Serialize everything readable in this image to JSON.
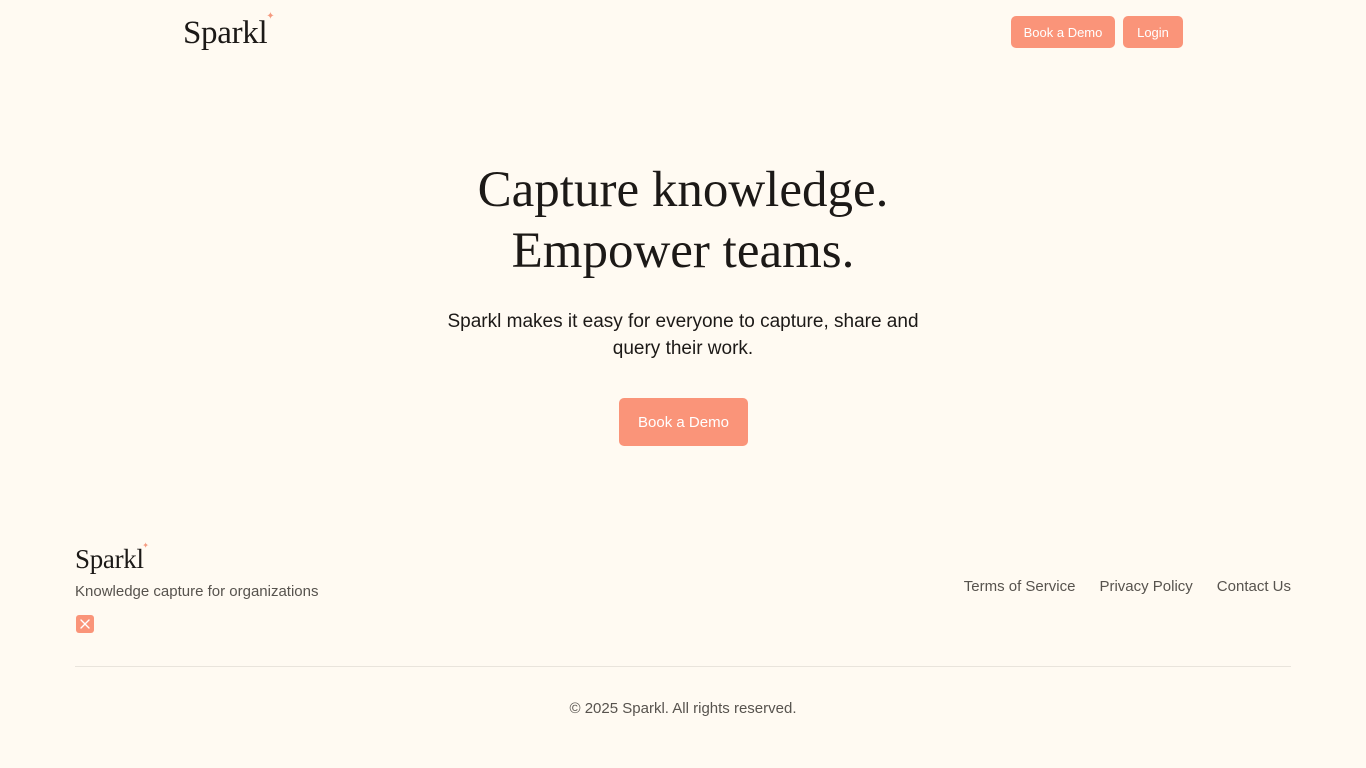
{
  "brand": {
    "name": "Sparkl",
    "accent_color": "#fa9479",
    "background_color": "#fffaf2"
  },
  "header": {
    "logo_text": "Sparkl",
    "book_demo_label": "Book a Demo",
    "login_label": "Login"
  },
  "hero": {
    "title_line1": "Capture knowledge.",
    "title_line2": "Empower teams.",
    "subtitle": "Sparkl makes it easy for everyone to capture, share and query their work.",
    "cta_label": "Book a Demo"
  },
  "footer": {
    "logo_text": "Sparkl",
    "tagline": "Knowledge capture for organizations",
    "social_icon": "x-icon",
    "links": [
      {
        "label": "Terms of Service"
      },
      {
        "label": "Privacy Policy"
      },
      {
        "label": "Contact Us"
      }
    ],
    "copyright": "© 2025 Sparkl. All rights reserved."
  }
}
